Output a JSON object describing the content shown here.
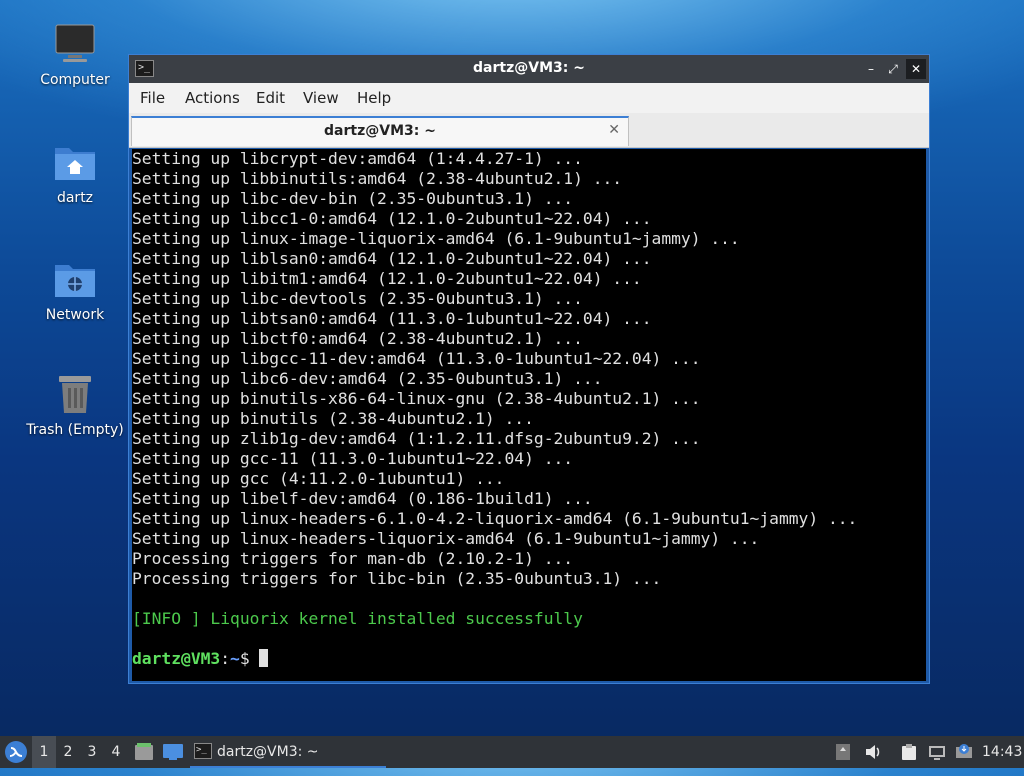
{
  "desktop": {
    "icons": [
      {
        "label": "Computer"
      },
      {
        "label": "dartz"
      },
      {
        "label": "Network"
      },
      {
        "label": "Trash (Empty)"
      }
    ]
  },
  "window": {
    "title": "dartz@VM3: ~",
    "menu": [
      "File",
      "Actions",
      "Edit",
      "View",
      "Help"
    ],
    "tab_title": "dartz@VM3: ~",
    "terminal_lines": [
      "Setting up libcrypt-dev:amd64 (1:4.4.27-1) ...",
      "Setting up libbinutils:amd64 (2.38-4ubuntu2.1) ...",
      "Setting up libc-dev-bin (2.35-0ubuntu3.1) ...",
      "Setting up libcc1-0:amd64 (12.1.0-2ubuntu1~22.04) ...",
      "Setting up linux-image-liquorix-amd64 (6.1-9ubuntu1~jammy) ...",
      "Setting up liblsan0:amd64 (12.1.0-2ubuntu1~22.04) ...",
      "Setting up libitm1:amd64 (12.1.0-2ubuntu1~22.04) ...",
      "Setting up libc-devtools (2.35-0ubuntu3.1) ...",
      "Setting up libtsan0:amd64 (11.3.0-1ubuntu1~22.04) ...",
      "Setting up libctf0:amd64 (2.38-4ubuntu2.1) ...",
      "Setting up libgcc-11-dev:amd64 (11.3.0-1ubuntu1~22.04) ...",
      "Setting up libc6-dev:amd64 (2.35-0ubuntu3.1) ...",
      "Setting up binutils-x86-64-linux-gnu (2.38-4ubuntu2.1) ...",
      "Setting up binutils (2.38-4ubuntu2.1) ...",
      "Setting up zlib1g-dev:amd64 (1:1.2.11.dfsg-2ubuntu9.2) ...",
      "Setting up gcc-11 (11.3.0-1ubuntu1~22.04) ...",
      "Setting up gcc (4:11.2.0-1ubuntu1) ...",
      "Setting up libelf-dev:amd64 (0.186-1build1) ...",
      "Setting up linux-headers-6.1.0-4.2-liquorix-amd64 (6.1-9ubuntu1~jammy) ...",
      "Setting up linux-headers-liquorix-amd64 (6.1-9ubuntu1~jammy) ...",
      "Processing triggers for man-db (2.10.2-1) ...",
      "Processing triggers for libc-bin (2.35-0ubuntu3.1) ..."
    ],
    "info_line": "[INFO ] Liquorix kernel installed successfully",
    "prompt": {
      "user_host": "dartz@VM3",
      "separator": ":",
      "path": "~",
      "symbol": "$ "
    }
  },
  "taskbar": {
    "workspaces": [
      "1",
      "2",
      "3",
      "4"
    ],
    "active_workspace": "1",
    "task_label": "dartz@VM3: ~",
    "clock": "14:43"
  },
  "colors": {
    "accent": "#3c7fd4",
    "prompt_user": "#5fe05f",
    "prompt_path": "#6aa0ff",
    "info_text": "#4cc94c"
  }
}
